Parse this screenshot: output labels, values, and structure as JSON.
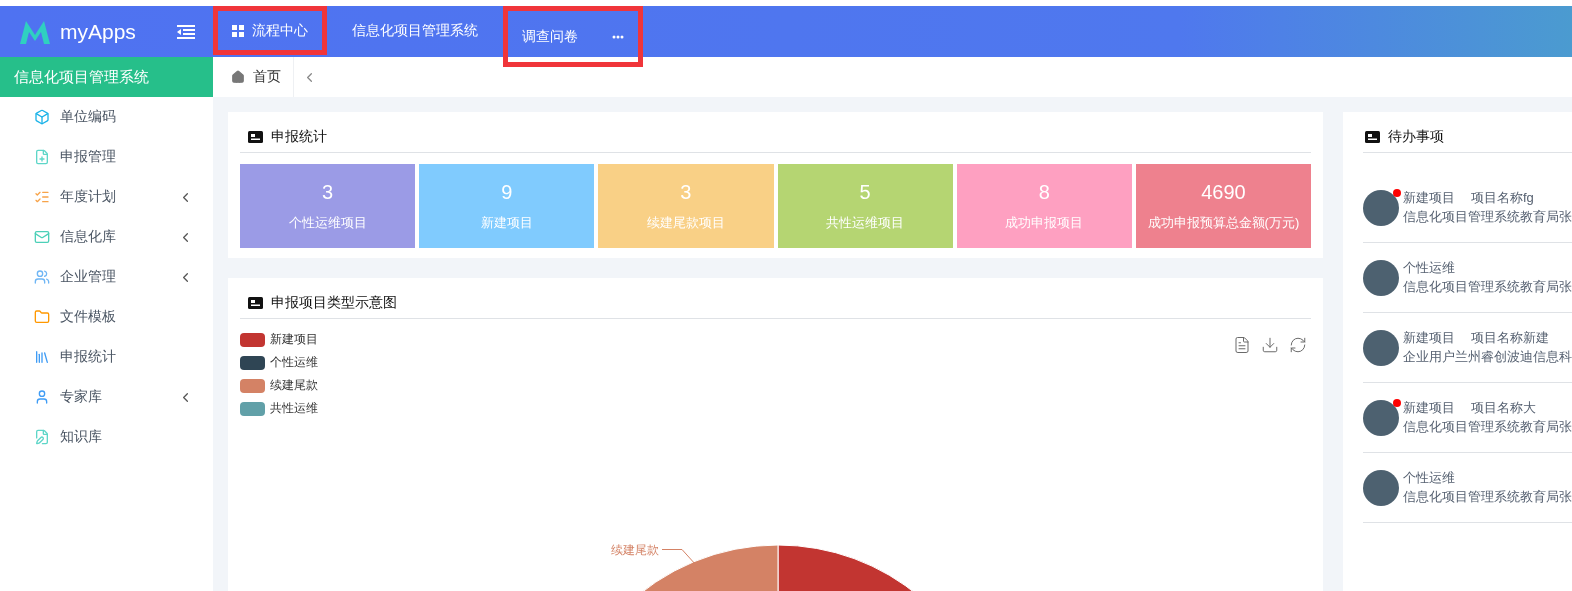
{
  "app": {
    "logo_text": "myApps"
  },
  "top_tabs": [
    {
      "label": "流程中心",
      "selected": false,
      "highlighted": true,
      "kind": "grid"
    },
    {
      "label": "信息化项目管理系统",
      "selected": false,
      "highlighted": false,
      "kind": "plain"
    },
    {
      "label": "调查问卷",
      "selected": false,
      "highlighted": true,
      "kind": "more"
    }
  ],
  "sidebar": {
    "title": "信息化项目管理系统",
    "items": [
      {
        "label": "单位编码",
        "expandable": false
      },
      {
        "label": "申报管理",
        "expandable": false
      },
      {
        "label": "年度计划",
        "expandable": true
      },
      {
        "label": "信息化库",
        "expandable": true
      },
      {
        "label": "企业管理",
        "expandable": true
      },
      {
        "label": "文件模板",
        "expandable": false
      },
      {
        "label": "申报统计",
        "expandable": false
      },
      {
        "label": "专家库",
        "expandable": true
      },
      {
        "label": "知识库",
        "expandable": false
      }
    ]
  },
  "breadcrumb": {
    "home": "首页"
  },
  "stats_card": {
    "title": "申报统计",
    "tiles": [
      {
        "value": "3",
        "label": "个性运维项目",
        "color": "#9b9be6"
      },
      {
        "value": "9",
        "label": "新建项目",
        "color": "#80cbfe"
      },
      {
        "value": "3",
        "label": "续建尾款项目",
        "color": "#f9d086"
      },
      {
        "value": "5",
        "label": "共性运维项目",
        "color": "#b5d572"
      },
      {
        "value": "8",
        "label": "成功申报项目",
        "color": "#fea0c1"
      },
      {
        "value": "4690",
        "label": "成功申报预算总金额(万元)",
        "color": "#ee818e"
      }
    ]
  },
  "chart_card": {
    "title": "申报项目类型示意图",
    "legend": [
      {
        "label": "新建项目",
        "color": "#c23531"
      },
      {
        "label": "个性运维",
        "color": "#2f4554"
      },
      {
        "label": "续建尾款",
        "color": "#d48265"
      },
      {
        "label": "共性运维",
        "color": "#61a0a8"
      }
    ],
    "callout_label": "续建尾款"
  },
  "todo_panel": {
    "title": "待办事项",
    "items": [
      {
        "type": "新建项目",
        "name": "项目名称fg",
        "detail": "信息化项目管理系统教育局张",
        "unread": true
      },
      {
        "type": "个性运维",
        "detail": "信息化项目管理系统教育局张",
        "unread": false
      },
      {
        "type": "新建项目",
        "name": "项目名称新建",
        "detail": "企业用户兰州睿创波迪信息科",
        "unread": false
      },
      {
        "type": "新建项目",
        "name": "项目名称大",
        "detail": "信息化项目管理系统教育局张",
        "unread": true
      },
      {
        "type": "个性运维",
        "detail": "信息化项目管理系统教育局张",
        "unread": false
      }
    ]
  }
}
